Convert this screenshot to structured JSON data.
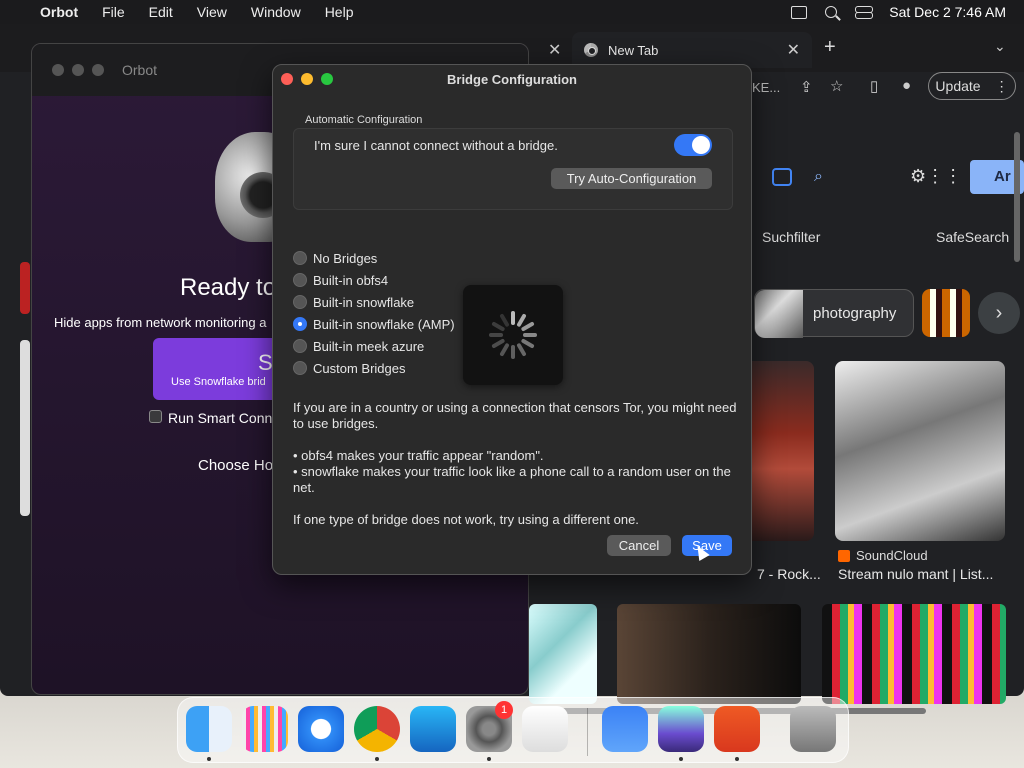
{
  "menubar": {
    "apple": "",
    "app_name": "Orbot",
    "items": [
      "File",
      "Edit",
      "View",
      "Window",
      "Help"
    ],
    "datetime": "Sat Dec 2  7:46 AM"
  },
  "chrome": {
    "tab_title": "New Tab",
    "tab_close": "✕",
    "other_tab_close": "✕",
    "new_tab": "+",
    "tab_menu": "⌄",
    "url_fragment": "KE...",
    "update_label": "Update",
    "update_menu": "⋮",
    "suchfilter": "Suchfilter",
    "safesearch": "SafeSearch",
    "ar_label": "Ar",
    "photo_chip": "photography",
    "next_arrow": "›",
    "soundcloud": "SoundCloud",
    "stream_title": "Stream nulo mant | List...",
    "rock_title": "7 - Rock..."
  },
  "orbot": {
    "title": "Orbot",
    "ready_text": "Ready to",
    "hide_apps": "Hide apps from network monitoring a",
    "start_label": "St",
    "start_sub": "Use Snowflake brid",
    "smart_label": "Run Smart Conne",
    "choose_how": "Choose Ho"
  },
  "dialog": {
    "title": "Bridge Configuration",
    "auto_section_title": "Automatic Configuration",
    "auto_label": "I'm sure I cannot connect without a bridge.",
    "auto_toggle_on": true,
    "try_button": "Try Auto-Configuration",
    "options": [
      {
        "label": "No Bridges",
        "selected": false
      },
      {
        "label": "Built-in obfs4",
        "selected": false
      },
      {
        "label": "Built-in snowflake",
        "selected": false
      },
      {
        "label": "Built-in snowflake (AMP)",
        "selected": true
      },
      {
        "label": "Built-in meek azure",
        "selected": false
      },
      {
        "label": "Custom Bridges",
        "selected": false
      }
    ],
    "desc1": "If you are in a country or using a connection that censors Tor, you might need to use bridges.",
    "desc2a": "• obfs4 makes your traffic appear \"random\".",
    "desc2b": "• snowflake makes your traffic look like a phone call to a random user on the net.",
    "desc3": "If one type of bridge does not work, try using a different one.",
    "cancel": "Cancel",
    "save": "Save"
  },
  "dock": {
    "badge": "1",
    "apps": [
      "finder",
      "launchpad",
      "safari",
      "chrome",
      "app-store",
      "system-settings",
      "textedit",
      "weather",
      "orbot",
      "remote-desktop",
      "trash"
    ]
  }
}
